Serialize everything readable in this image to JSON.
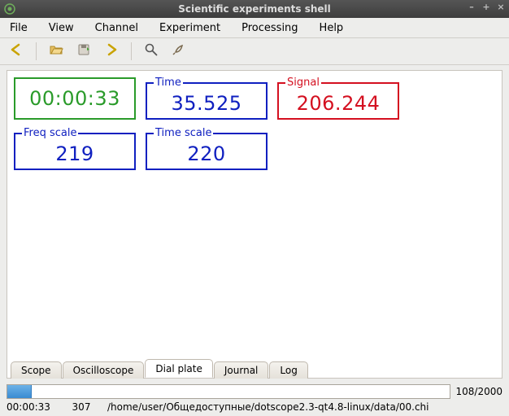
{
  "title": "Scientific experiments shell",
  "menu": {
    "items": [
      {
        "label": "File"
      },
      {
        "label": "View"
      },
      {
        "label": "Channel"
      },
      {
        "label": "Experiment"
      },
      {
        "label": "Processing"
      },
      {
        "label": "Help"
      }
    ]
  },
  "toolbar": {
    "icons": {
      "back": "back-icon",
      "open": "open-icon",
      "save": "save-icon",
      "forward": "forward-icon",
      "zoom": "zoom-icon",
      "tool": "tool-icon"
    }
  },
  "readouts": {
    "elapsed": {
      "label": "",
      "value": "00:00:33",
      "color": "green"
    },
    "time": {
      "label": "Time",
      "value": "35.525",
      "color": "blue"
    },
    "signal": {
      "label": "Signal",
      "value": "206.244",
      "color": "red"
    },
    "freq_scale": {
      "label": "Freq scale",
      "value": "219",
      "color": "blue"
    },
    "time_scale": {
      "label": "Time scale",
      "value": "220",
      "color": "blue"
    }
  },
  "tabs": {
    "items": [
      {
        "label": "Scope"
      },
      {
        "label": "Oscilloscope"
      },
      {
        "label": "Dial plate"
      },
      {
        "label": "Journal"
      },
      {
        "label": "Log"
      }
    ],
    "active_index": 2
  },
  "progress": {
    "current": 108,
    "total": 2000,
    "label": "108/2000",
    "percent": 5.4
  },
  "status": {
    "time": "00:00:33",
    "count": "307",
    "path": "/home/user/Общедоступные/dotscope2.3-qt4.8-linux/data/00.chi"
  },
  "colors": {
    "green": "#2a9b2a",
    "blue": "#1020c0",
    "red": "#d41020"
  }
}
